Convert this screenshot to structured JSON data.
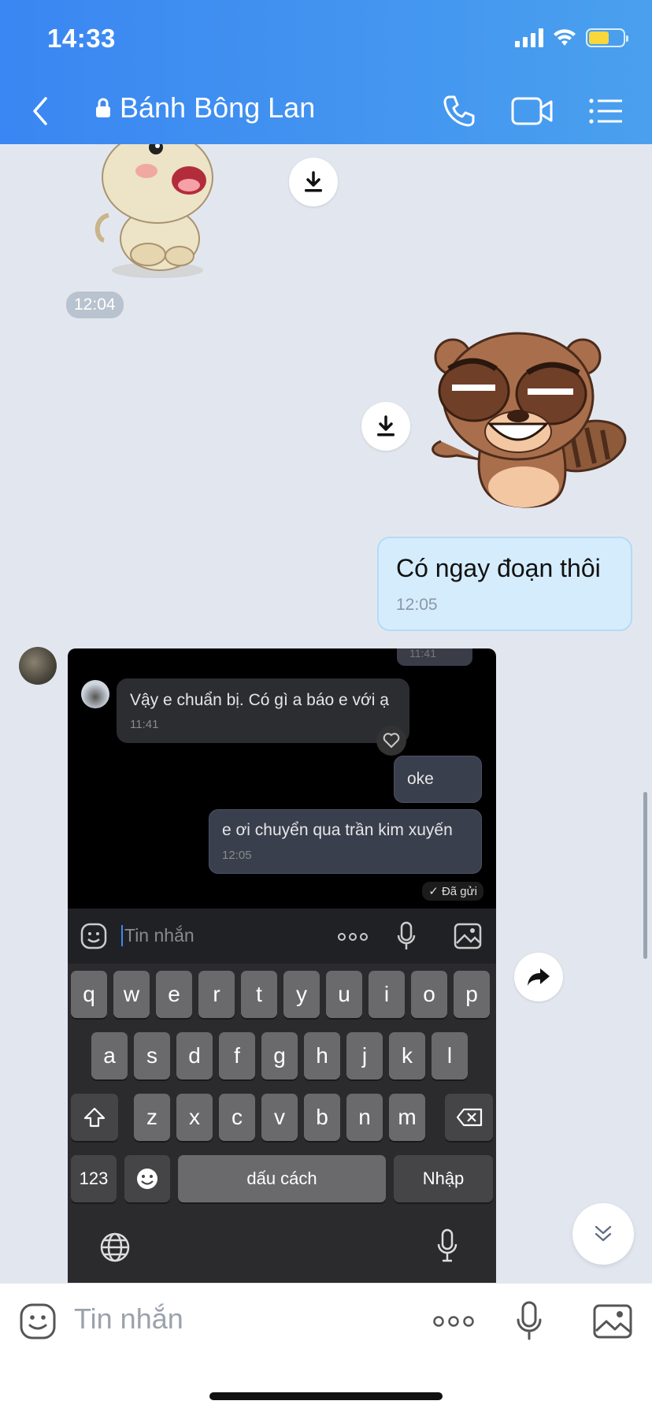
{
  "status_bar": {
    "time": "14:33"
  },
  "header": {
    "title": "Bánh Bông Lan"
  },
  "messages": {
    "sticker1_time": "12:04",
    "outgoing_text": "Có ngay đoạn thôi",
    "outgoing_time": "12:05"
  },
  "screenshot": {
    "top_fragment_time": "11:41",
    "incoming_text": "Vậy e chuẩn bị. Có gì a báo e với ạ",
    "incoming_time": "11:41",
    "out1_text": "oke",
    "out2_text": "e ơi chuyển qua trần kim xuyến",
    "out2_time": "12:05",
    "sent_status": "Đã gửi",
    "input_placeholder": "Tin nhắn",
    "keyboard": {
      "row1": [
        "q",
        "w",
        "e",
        "r",
        "t",
        "y",
        "u",
        "i",
        "o",
        "p"
      ],
      "row2": [
        "a",
        "s",
        "d",
        "f",
        "g",
        "h",
        "j",
        "k",
        "l"
      ],
      "row3": [
        "z",
        "x",
        "c",
        "v",
        "b",
        "n",
        "m"
      ],
      "numbers_key": "123",
      "space_key": "dấu cách",
      "return_key": "Nhập"
    }
  },
  "composer": {
    "placeholder": "Tin nhắn"
  },
  "colors": {
    "header_start": "#3a86f2",
    "header_end": "#4aa0ee",
    "chat_bg": "#e2e7ef",
    "outgoing_bubble": "#d5ecfc"
  }
}
